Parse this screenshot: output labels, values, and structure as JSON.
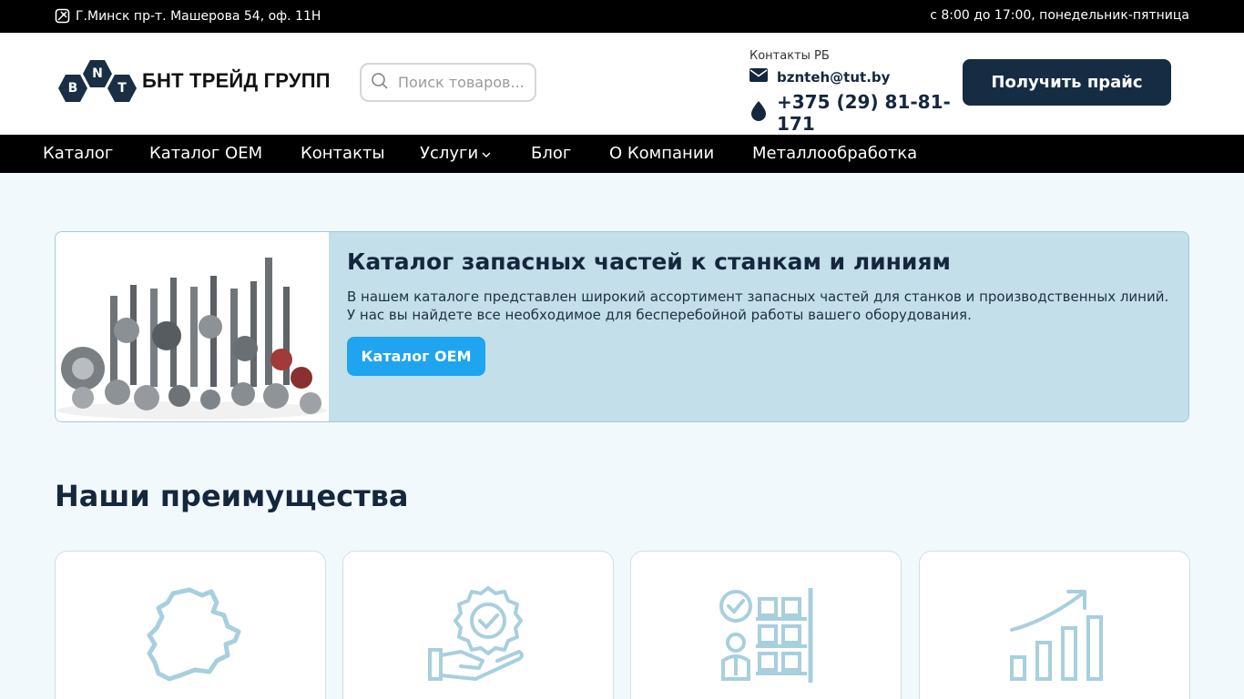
{
  "topbar": {
    "address": "Г.Минск пр-т. Машерова 54, оф. 11Н",
    "hours": "с 8:00 до 17:00, понедельник-пятница"
  },
  "header": {
    "logo_letters": [
      "B",
      "N",
      "T"
    ],
    "logo_text": "БНТ ТРЕЙД ГРУПП",
    "search_placeholder": "Поиск товаров...",
    "contacts_label": "Контакты РБ",
    "email": "bznteh@tut.by",
    "phone": "+375 (29) 81-81-171",
    "price_button": "Получить прайс"
  },
  "nav": {
    "items": [
      "Каталог",
      "Каталог ОЕМ",
      "Контакты",
      "Услуги",
      "Блог",
      "О Компании",
      "Металлообработка"
    ]
  },
  "banner": {
    "title": "Каталог запасных частей к станкам и линиям",
    "line1": "В нашем каталоге представлен широкий ассортимент запасных частей для станков и производственных линий.",
    "line2": "У нас вы найдете все необходимое для бесперебойной работы вашего оборудования.",
    "button": "Каталог ОЕМ"
  },
  "advantages": {
    "title": "Наши преимущества",
    "icons": [
      "belarus-map-icon",
      "quality-hand-icon",
      "warehouse-worker-icon",
      "growth-chart-icon"
    ]
  },
  "colors": {
    "dark": "#14273d",
    "accent": "#1fa4ef",
    "banner_bg": "#c2dfea",
    "icon_stroke": "#a8cfdd"
  }
}
